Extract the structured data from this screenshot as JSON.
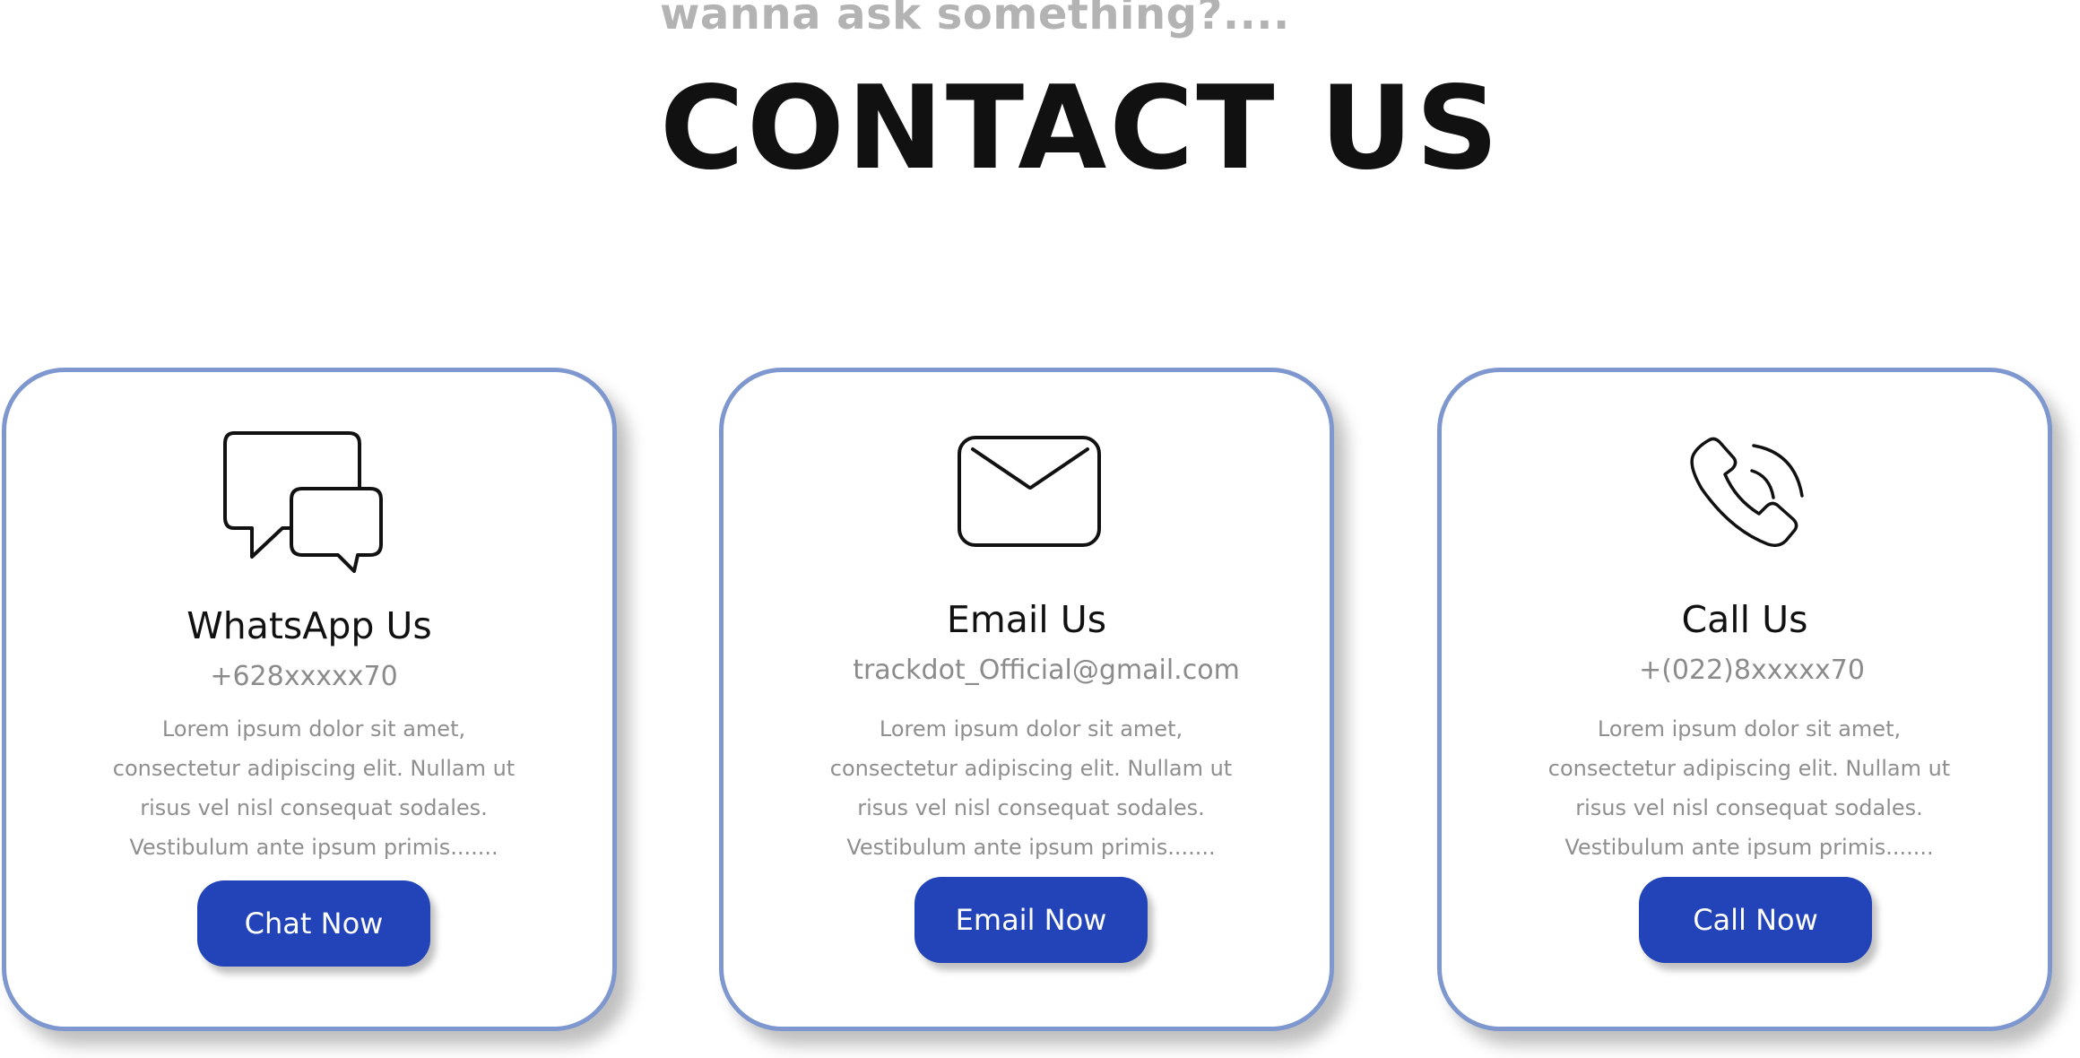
{
  "header": {
    "tagline": "wanna ask something?....",
    "title": "CONTACT US"
  },
  "cards": [
    {
      "icon": "chat-bubbles-icon",
      "title": "WhatsApp Us",
      "detail": "+628xxxxx70",
      "description": "Lorem ipsum dolor sit amet, consectetur adipiscing elit. Nullam ut risus vel nisl consequat sodales. Vestibulum ante ipsum primis.......",
      "button_label": "Chat Now"
    },
    {
      "icon": "envelope-icon",
      "title": "Email Us",
      "detail": "trackdot_Official@gmail.com",
      "description": "Lorem ipsum dolor sit amet, consectetur adipiscing elit. Nullam ut risus vel nisl consequat sodales. Vestibulum ante ipsum primis.......",
      "button_label": "Email Now"
    },
    {
      "icon": "phone-icon",
      "title": "Call Us",
      "detail": "+(022)8xxxxx70",
      "description": "Lorem ipsum dolor sit amet, consectetur adipiscing elit. Nullam ut risus vel nisl consequat sodales. Vestibulum ante ipsum primis.......",
      "button_label": "Call Now"
    }
  ],
  "colors": {
    "accent": "#2244b8",
    "card_border": "#7f97cf",
    "muted_text": "#8f8f8f",
    "tagline": "#b3b3b3"
  }
}
